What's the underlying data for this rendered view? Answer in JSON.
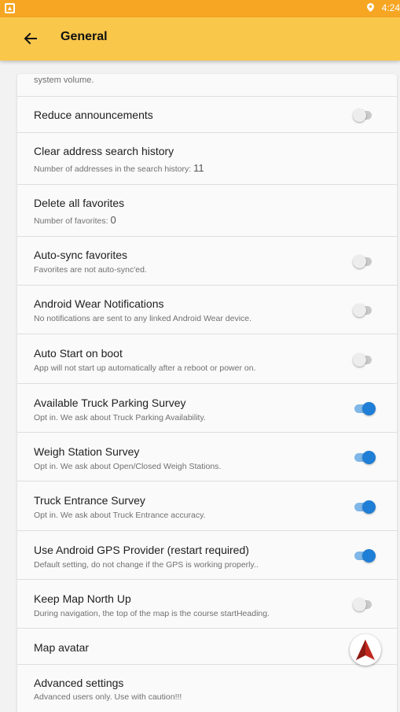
{
  "status_bar": {
    "time": "4:24"
  },
  "app_bar": {
    "title": "General"
  },
  "settings": {
    "partial_top": {
      "subtitle": "system volume."
    },
    "reduce_announcements": {
      "title": "Reduce announcements",
      "enabled": false
    },
    "clear_address_history": {
      "title": "Clear address search history",
      "subtitle": "Number of addresses in the search history:",
      "count": "11"
    },
    "delete_favorites": {
      "title": "Delete all favorites",
      "subtitle": "Number of favorites:",
      "count": "0"
    },
    "auto_sync_favorites": {
      "title": "Auto-sync favorites",
      "subtitle": "Favorites are not auto-sync'ed.",
      "enabled": false
    },
    "android_wear": {
      "title": "Android Wear Notifications",
      "subtitle": "No notifications are sent to any linked Android Wear device.",
      "enabled": false
    },
    "auto_start_boot": {
      "title": "Auto Start on boot",
      "subtitle": "App will not start up automatically after a reboot or power on.",
      "enabled": false
    },
    "truck_parking_survey": {
      "title": "Available Truck Parking Survey",
      "subtitle": "Opt in. We ask about Truck Parking Availability.",
      "enabled": true
    },
    "weigh_station_survey": {
      "title": "Weigh Station Survey",
      "subtitle": "Opt in. We ask about Open/Closed Weigh Stations.",
      "enabled": true
    },
    "truck_entrance_survey": {
      "title": "Truck Entrance Survey",
      "subtitle": "Opt in. We ask about Truck Entrance accuracy.",
      "enabled": true
    },
    "android_gps_provider": {
      "title": "Use Android GPS Provider (restart required)",
      "subtitle": "Default setting, do not change if the GPS is working properly..",
      "enabled": true
    },
    "keep_map_north_up": {
      "title": "Keep Map North Up",
      "subtitle": "During navigation, the top of the map is the course startHeading.",
      "enabled": false
    },
    "map_avatar": {
      "title": "Map avatar"
    },
    "advanced_settings": {
      "title": "Advanced settings",
      "subtitle": "Advanced users only. Use with caution!!!"
    }
  },
  "colors": {
    "status_bar": "#f6a623",
    "app_bar": "#f9c74a",
    "switch_on": "#1f7ed6",
    "switch_on_track": "#7fb7e8",
    "switch_off_track": "#c9c9c9",
    "avatar_arrow": "#c0281f"
  }
}
